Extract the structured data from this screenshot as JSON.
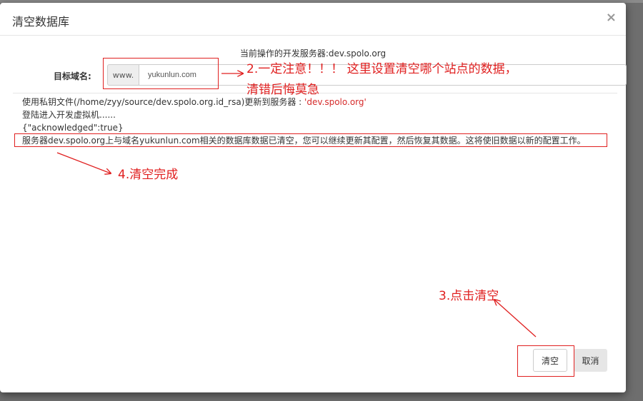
{
  "dialog": {
    "title": "清空数据库",
    "close_glyph": "×",
    "server_line": "当前操作的开发服务器:dev.spolo.org",
    "domain_label": "目标域名:",
    "domain_prefix": "www.",
    "domain_value": "yukunlun.com"
  },
  "log": {
    "line1_prefix": "使用私钥文件(/home/zyy/source/dev.spolo.org.id_rsa)更新到服务器 : ",
    "line1_server": "'dev.spolo.org'",
    "line2": "登陆进入开发虚拟机......",
    "line3": "{\"acknowledged\":true}",
    "line4": "服务器dev.spolo.org上与域名yukunlun.com相关的数据库数据已清空，您可以继续更新其配置，然后恢复其数据。这将使旧数据以新的配置工作。"
  },
  "buttons": {
    "clear_label": "清空",
    "cancel_label": "取消"
  },
  "annotations": {
    "note_domain_line1": "2.一定注意！！！ 这里设置清空哪个站点的数据，",
    "note_domain_line2": "清错后悔莫急",
    "note_click": "3.点击清空",
    "note_done": "4.清空完成",
    "color": "#e02020"
  }
}
